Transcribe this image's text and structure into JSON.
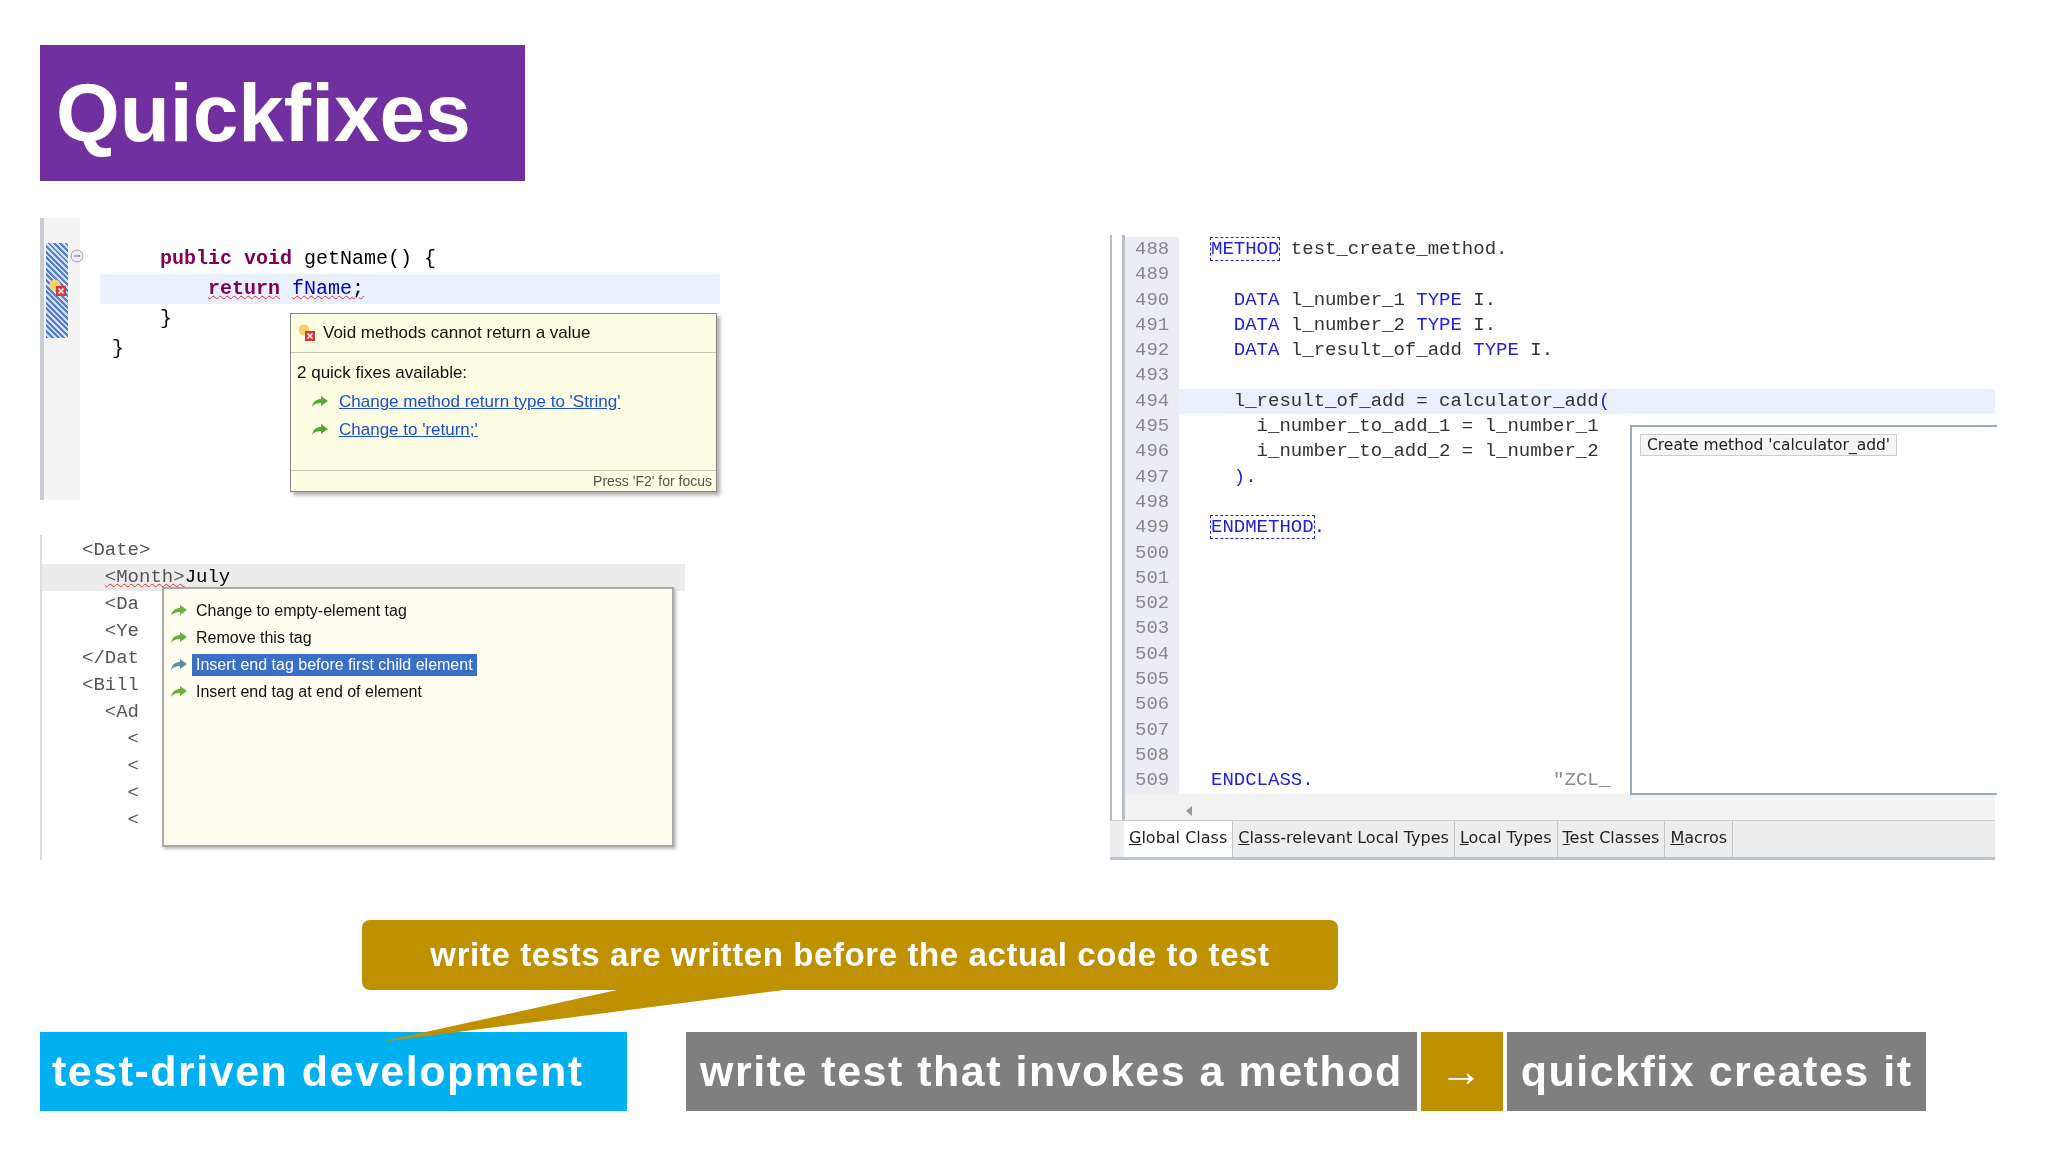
{
  "title": "Quickfixes",
  "java_editor": {
    "lines": [
      {
        "current": false,
        "tokens": [
          {
            "kind": "keyword",
            "text": "    public"
          },
          {
            "kind": "keyword",
            "text": " void"
          },
          {
            "kind": "plain",
            "text": " getName() {"
          }
        ]
      },
      {
        "current": true,
        "tokens": [
          {
            "kind": "keyword_err",
            "text": "        return"
          },
          {
            "kind": "field_err",
            "text": " fName"
          },
          {
            "kind": "plain_err",
            "text": ";"
          }
        ]
      },
      {
        "current": false,
        "tokens": [
          {
            "kind": "plain",
            "text": "    }"
          }
        ]
      },
      {
        "current": false,
        "tokens": [
          {
            "kind": "plain",
            "text": "}"
          }
        ]
      }
    ],
    "hover": {
      "message": "Void methods cannot return a value",
      "subtitle": "2 quick fixes available:",
      "fixes": [
        "Change method return type to 'String'",
        "Change to 'return;'"
      ],
      "footer": "Press 'F2' for focus"
    }
  },
  "xml_editor": {
    "lines": [
      {
        "current": false,
        "tokens": [
          {
            "kind": "tag",
            "text": "<Date>"
          }
        ]
      },
      {
        "current": true,
        "tokens": [
          {
            "kind": "tag_err",
            "text": "  <Month>"
          },
          {
            "kind": "plain",
            "text": "July"
          }
        ]
      },
      {
        "current": false,
        "tokens": [
          {
            "kind": "tag",
            "text": "  <Da"
          }
        ]
      },
      {
        "current": false,
        "tokens": [
          {
            "kind": "tag",
            "text": "  <Ye"
          }
        ]
      },
      {
        "current": false,
        "tokens": [
          {
            "kind": "tag",
            "text": "</Dat"
          }
        ]
      },
      {
        "current": false,
        "tokens": [
          {
            "kind": "tag",
            "text": "<Bill"
          }
        ]
      },
      {
        "current": false,
        "tokens": [
          {
            "kind": "tag",
            "text": "  <Ad"
          }
        ]
      },
      {
        "current": false,
        "tokens": [
          {
            "kind": "tag",
            "text": "    <"
          }
        ]
      },
      {
        "current": false,
        "tokens": [
          {
            "kind": "tag",
            "text": "    <"
          }
        ]
      },
      {
        "current": false,
        "tokens": [
          {
            "kind": "tag",
            "text": "    <"
          }
        ]
      },
      {
        "current": false,
        "tokens": [
          {
            "kind": "tag",
            "text": "    <"
          }
        ]
      }
    ],
    "proposals": [
      {
        "label": "Change to empty-element tag",
        "selected": false
      },
      {
        "label": "Remove this tag",
        "selected": false
      },
      {
        "label": "Insert end tag before first child element",
        "selected": true
      },
      {
        "label": "Insert end tag at end of element",
        "selected": false
      }
    ]
  },
  "abap_editor": {
    "lines": [
      {
        "number": "488",
        "current": false,
        "tokens": [
          {
            "kind": "boxed",
            "text": "METHOD"
          },
          {
            "kind": "plain",
            "text": " test_create_method."
          }
        ]
      },
      {
        "number": "489",
        "current": false
      },
      {
        "number": "490",
        "current": false,
        "tokens": [
          {
            "kind": "keyword",
            "text": "  DATA"
          },
          {
            "kind": "plain",
            "text": " l_number_1 "
          },
          {
            "kind": "keyword",
            "text": "TYPE"
          },
          {
            "kind": "plain",
            "text": " I."
          }
        ]
      },
      {
        "number": "491",
        "current": false,
        "tokens": [
          {
            "kind": "keyword",
            "text": "  DATA"
          },
          {
            "kind": "plain",
            "text": " l_number_2 "
          },
          {
            "kind": "keyword",
            "text": "TYPE"
          },
          {
            "kind": "plain",
            "text": " I."
          }
        ]
      },
      {
        "number": "492",
        "current": false,
        "tokens": [
          {
            "kind": "keyword",
            "text": "  DATA"
          },
          {
            "kind": "plain",
            "text": " l_result_of_add "
          },
          {
            "kind": "keyword",
            "text": "TYPE"
          },
          {
            "kind": "plain",
            "text": " I."
          }
        ]
      },
      {
        "number": "493",
        "current": false
      },
      {
        "number": "494",
        "current": true,
        "tokens": [
          {
            "kind": "plain",
            "text": "  l_result_of_add = calculator_add"
          },
          {
            "kind": "keyword",
            "text": "("
          }
        ]
      },
      {
        "number": "495",
        "current": false,
        "tokens": [
          {
            "kind": "plain",
            "text": "    i_number_to_add_1 = l_number_1"
          }
        ]
      },
      {
        "number": "496",
        "current": false,
        "tokens": [
          {
            "kind": "plain",
            "text": "    i_number_to_add_2 = l_number_2"
          }
        ]
      },
      {
        "number": "497",
        "current": false,
        "tokens": [
          {
            "kind": "keyword",
            "text": "  )."
          }
        ]
      },
      {
        "number": "498",
        "current": false
      },
      {
        "number": "499",
        "current": false,
        "tokens": [
          {
            "kind": "boxed",
            "text": "ENDMETHOD"
          },
          {
            "kind": "keyword",
            "text": "."
          }
        ]
      },
      {
        "number": "500",
        "current": false
      },
      {
        "number": "501",
        "current": false
      },
      {
        "number": "502",
        "current": false
      },
      {
        "number": "503",
        "current": false
      },
      {
        "number": "504",
        "current": false
      },
      {
        "number": "505",
        "current": false
      },
      {
        "number": "506",
        "current": false
      },
      {
        "number": "507",
        "current": false
      },
      {
        "number": "508",
        "current": false
      },
      {
        "number": "509",
        "current": false,
        "tokens": [
          {
            "kind": "keyword",
            "text": "ENDCLASS."
          },
          {
            "kind": "comment",
            "text": "                     \"ZCL_"
          }
        ]
      }
    ],
    "proposal": "Create method 'calculator_add'",
    "tabs": [
      {
        "label": "Global Class",
        "selected": true
      },
      {
        "label": "Class-relevant Local Types",
        "selected": false
      },
      {
        "label": "Local Types",
        "selected": false
      },
      {
        "label": "Test Classes",
        "selected": false
      },
      {
        "label": "Macros",
        "selected": false
      }
    ]
  },
  "callout": "write tests are written before the actual code to test",
  "tdd_label": "test-driven development",
  "steps": [
    "write test that invokes a method",
    "quickfix creates it"
  ],
  "arrow": "→"
}
